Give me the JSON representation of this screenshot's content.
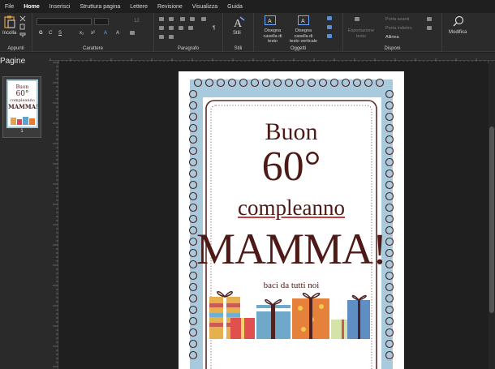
{
  "menubar": {
    "tabs": [
      "File",
      "Home",
      "Inserisci",
      "Struttura pagina",
      "Lettere",
      "Revisione",
      "Visualizza",
      "Guida"
    ],
    "active": "Home"
  },
  "ribbon": {
    "groups": {
      "appunti": "Appunti",
      "carattere": "Carattere",
      "paragrafo": "Paragrafo",
      "stili": "Stili",
      "oggetti": "Oggetti",
      "disponi": "Disponi"
    },
    "incolla": "Incolla",
    "stili_btn": "Stili",
    "disegna_casella": "Disegna casella di testo",
    "disegna_casella_verticale": "Disegna casella di testo verticale",
    "esportazione_testo": "Esportazione testo",
    "porta_avanti": "Porta avanti",
    "porta_indietro": "Porta indietro",
    "allinea": "Allinea",
    "modifica": "Modifica",
    "font_size": "12"
  },
  "pages_pane": {
    "title": "Pagine",
    "page_number": "1"
  },
  "card": {
    "line1": "Buon",
    "line2": "60°",
    "line3": "compleanno",
    "line4": "MAMMA!",
    "line5": "baci da tutti noi"
  },
  "colors": {
    "frame_blue": "#a9c9dc",
    "text_brown": "#4d1a17"
  }
}
